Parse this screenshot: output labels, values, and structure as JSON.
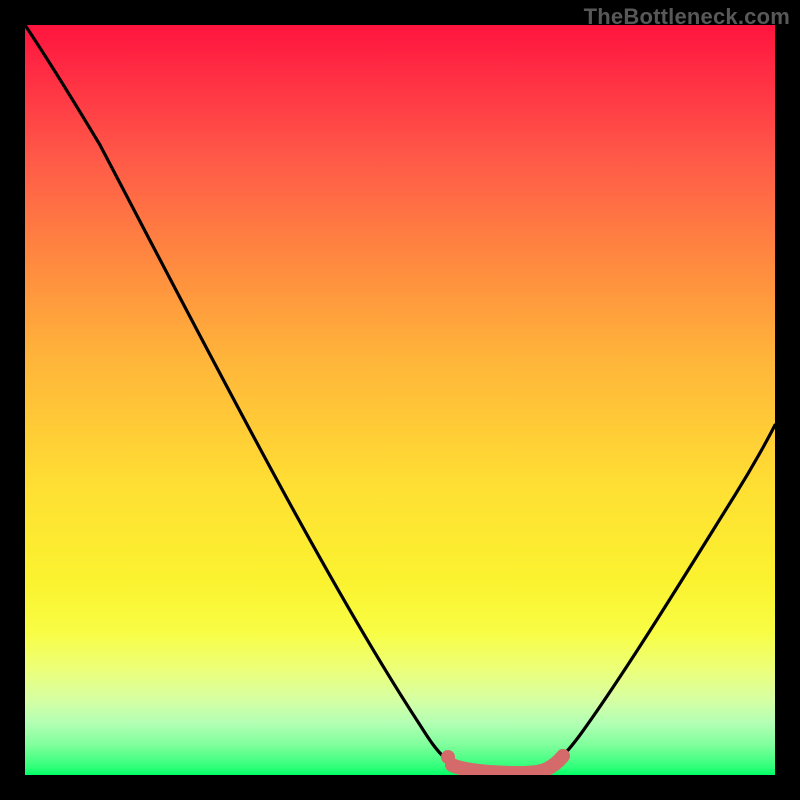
{
  "attribution": "TheBottleneck.com",
  "chart_data": {
    "type": "line",
    "title": "",
    "xlabel": "",
    "ylabel": "",
    "xlim": [
      0,
      100
    ],
    "ylim": [
      0,
      100
    ],
    "series": [
      {
        "name": "bottleneck-curve",
        "x": [
          0,
          5,
          10,
          15,
          20,
          25,
          30,
          35,
          40,
          45,
          50,
          52,
          55,
          59,
          62,
          65,
          68,
          70,
          73,
          77,
          82,
          88,
          94,
          100
        ],
        "y": [
          100,
          95.5,
          89,
          81,
          72,
          63,
          54,
          44,
          34,
          24,
          14,
          10,
          6,
          2,
          0.5,
          0,
          0.5,
          2,
          5,
          11,
          20,
          31,
          42,
          52
        ]
      },
      {
        "name": "zero-bottleneck-highlight",
        "x": [
          56,
          58,
          60,
          62,
          64,
          66,
          68,
          70,
          72
        ],
        "y": [
          0.5,
          0.0,
          0.0,
          0.0,
          0.0,
          0.0,
          0.1,
          0.3,
          0.6
        ]
      }
    ],
    "gradient_stops": [
      {
        "pct": 0,
        "color": "#ff143e"
      },
      {
        "pct": 100,
        "color": "#00ff66"
      }
    ]
  }
}
